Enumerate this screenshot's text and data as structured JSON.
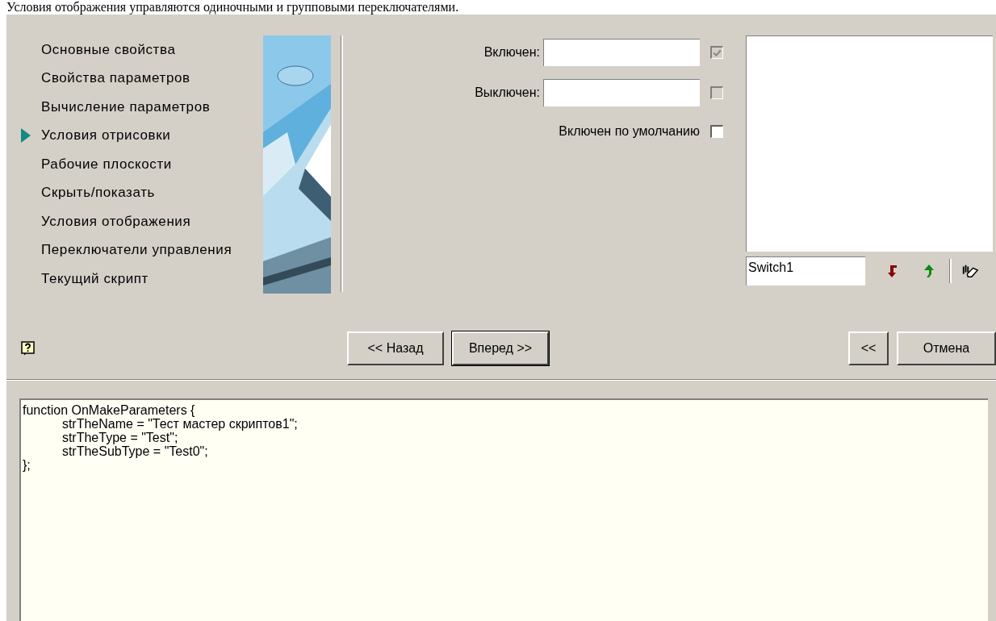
{
  "caption": "Условия отображения управляются одиночными и групповыми переключателями.",
  "nav": {
    "items": [
      {
        "label": "Основные свойства",
        "selected": false
      },
      {
        "label": "Свойства параметров",
        "selected": false
      },
      {
        "label": "Вычисление параметров",
        "selected": false
      },
      {
        "label": "Условия отрисовки",
        "selected": true
      },
      {
        "label": "Рабочие плоскости",
        "selected": false
      },
      {
        "label": "Скрыть/показать",
        "selected": false
      },
      {
        "label": "Условия отображения",
        "selected": false
      },
      {
        "label": "Переключатели управления",
        "selected": false
      },
      {
        "label": "Текущий скрипт",
        "selected": false
      }
    ]
  },
  "fields": [
    {
      "label": "Включен:",
      "checked": true,
      "disabled": true
    },
    {
      "label": "Выключен:",
      "checked": false,
      "disabled": true
    }
  ],
  "default_option": {
    "label": "Включен по умолчанию",
    "checked": false,
    "disabled": false
  },
  "switch_name": {
    "value": "Switch1"
  },
  "nav_buttons": [
    {
      "label": "<< Назад",
      "default": false
    },
    {
      "label": "Вперед >>",
      "default": true
    }
  ],
  "right_buttons": [
    {
      "label": "<<",
      "default": false
    },
    {
      "label": "Отмена",
      "default": false
    }
  ],
  "code": {
    "lines": [
      "function OnMakeParameters {",
      "\tstrTheName = \"Тест мастер скриптов1\";",
      "\tstrTheType = \"Test\";",
      "\tstrTheSubType = \"Test0\";",
      "};"
    ]
  }
}
